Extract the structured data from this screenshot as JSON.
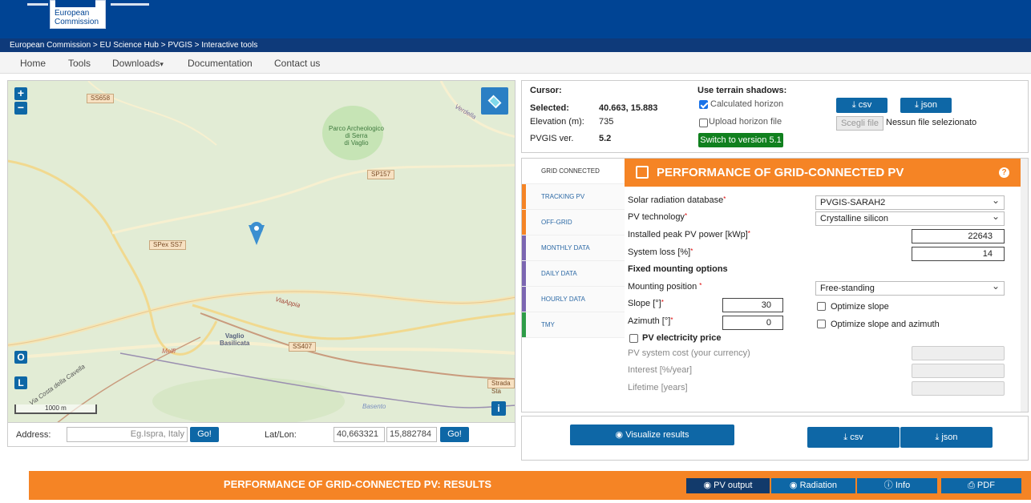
{
  "header": {
    "logo_line1": "European",
    "logo_line2": "Commission",
    "breadcrumb": "European Commission > EU Science Hub > PVGIS > Interactive tools"
  },
  "nav": {
    "items": [
      "Home",
      "Tools",
      "Downloads",
      "Documentation",
      "Contact us"
    ],
    "downloads_caret": "▾"
  },
  "map": {
    "zoom_in": "+",
    "zoom_out": "−",
    "btn_o": "O",
    "btn_l": "L",
    "btn_i": "i",
    "scale": "1000 m",
    "road_labels": [
      "SS658",
      "SP157",
      "SPex SS7",
      "SS407",
      "Strada Sta"
    ],
    "place_labels": [
      "Verdella",
      "ViaAppia",
      "Melfi",
      "Via Costa della Cavella",
      "Basento"
    ],
    "park_label": [
      "Parco Archeologico",
      "di Serra",
      "di Vaglio"
    ],
    "town_label": [
      "Vaglio",
      "Basilicata"
    ]
  },
  "address": {
    "address_label": "Address:",
    "address_placeholder": "Eg.Ispra, Italy",
    "go": "Go!",
    "latlon_label": "Lat/Lon:",
    "lat": "40,663321",
    "lon": "15,882784"
  },
  "info": {
    "cursor_label": "Cursor:",
    "selected_label": "Selected:",
    "selected_value": "40.663, 15.883",
    "elevation_label": "Elevation (m):",
    "elevation_value": "735",
    "version_label": "PVGIS ver.",
    "version_value": "5.2",
    "terrain_title": "Use terrain shadows:",
    "calculated_horizon": "Calculated horizon",
    "upload_horizon": "Upload horizon file",
    "switch_btn": "Switch to version 5.1",
    "csv": "csv",
    "json": "json",
    "choose_file": "Scegli file",
    "no_file": "Nessun file selezionato"
  },
  "tabs": [
    {
      "label": "GRID CONNECTED",
      "accent": "#ffffff"
    },
    {
      "label": "TRACKING PV",
      "accent": "#f58425"
    },
    {
      "label": "OFF-GRID",
      "accent": "#f58425"
    },
    {
      "label": "MONTHLY DATA",
      "accent": "#7b66b1"
    },
    {
      "label": "DAILY DATA",
      "accent": "#7b66b1"
    },
    {
      "label": "HOURLY DATA",
      "accent": "#7b66b1"
    },
    {
      "label": "TMY",
      "accent": "#2e9c48"
    }
  ],
  "form": {
    "header_title": "PERFORMANCE OF GRID-CONNECTED PV",
    "help": "?",
    "radiation_db_label": "Solar radiation database",
    "radiation_db_value": "PVGIS-SARAH2",
    "pv_tech_label": "PV technology",
    "pv_tech_value": "Crystalline silicon",
    "peak_power_label": "Installed peak PV power [kWp]",
    "peak_power_value": "22643",
    "system_loss_label": "System loss [%]",
    "system_loss_value": "14",
    "fixed_mounting_title": "Fixed mounting options",
    "mounting_position_label": "Mounting position",
    "mounting_position_value": "Free-standing",
    "slope_label": "Slope [°]",
    "slope_value": "30",
    "optimize_slope": "Optimize slope",
    "azimuth_label": "Azimuth [°]",
    "azimuth_value": "0",
    "optimize_slope_azimuth": "Optimize slope and azimuth",
    "pv_price_label": "PV electricity price",
    "system_cost_label": "PV system cost (your currency)",
    "interest_label": "Interest [%/year]",
    "lifetime_label": "Lifetime [years]",
    "required_mark": "*"
  },
  "actions": {
    "visualize": "Visualize results",
    "csv": "csv",
    "json": "json"
  },
  "results": {
    "title": "PERFORMANCE OF GRID-CONNECTED PV: RESULTS",
    "pv_output": "PV output",
    "radiation": "Radiation",
    "info": "Info",
    "pdf": "PDF"
  }
}
